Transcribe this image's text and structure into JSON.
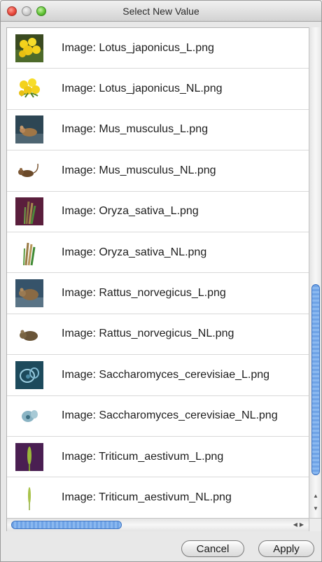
{
  "window": {
    "title": "Select New Value"
  },
  "list": {
    "items": [
      {
        "label": "Image: Lotus_japonicus_L.png",
        "icon": "lotus-flower-icon"
      },
      {
        "label": "Image: Lotus_japonicus_NL.png",
        "icon": "lotus-flower-icon"
      },
      {
        "label": "Image: Mus_musculus_L.png",
        "icon": "mouse-icon"
      },
      {
        "label": "Image: Mus_musculus_NL.png",
        "icon": "mouse-icon"
      },
      {
        "label": "Image: Oryza_sativa_L.png",
        "icon": "rice-plant-icon"
      },
      {
        "label": "Image: Oryza_sativa_NL.png",
        "icon": "rice-plant-icon"
      },
      {
        "label": "Image: Rattus_norvegicus_L.png",
        "icon": "rat-icon"
      },
      {
        "label": "Image: Rattus_norvegicus_NL.png",
        "icon": "rat-icon"
      },
      {
        "label": "Image: Saccharomyces_cerevisiae_L.png",
        "icon": "yeast-cell-icon"
      },
      {
        "label": "Image: Saccharomyces_cerevisiae_NL.png",
        "icon": "yeast-cell-icon"
      },
      {
        "label": "Image: Triticum_aestivum_L.png",
        "icon": "wheat-icon"
      },
      {
        "label": "Image: Triticum_aestivum_NL.png",
        "icon": "wheat-icon"
      }
    ]
  },
  "buttons": {
    "cancel": "Cancel",
    "apply": "Apply"
  },
  "colors": {
    "scroll_accent": "#6fa3e6",
    "titlebar": "#d2d2d2"
  }
}
